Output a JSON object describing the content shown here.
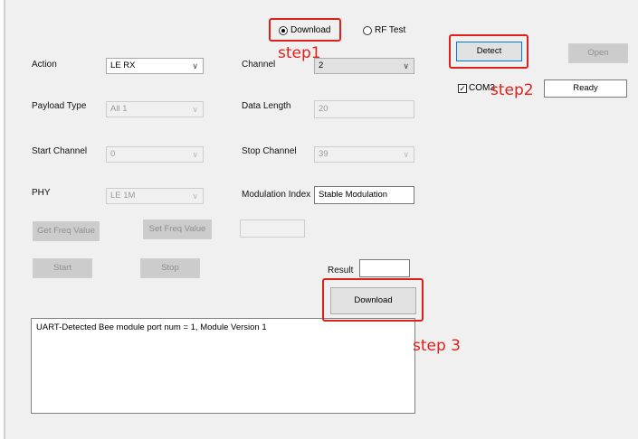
{
  "mode": {
    "download_label": "Download",
    "rf_test_label": "RF Test",
    "selected": "Download"
  },
  "form": {
    "action_label": "Action",
    "action_value": "LE RX",
    "channel_label": "Channel",
    "channel_value": "2",
    "payload_type_label": "Payload Type",
    "payload_type_value": "All 1",
    "data_length_label": "Data Length",
    "data_length_value": "20",
    "start_channel_label": "Start Channel",
    "start_channel_value": "0",
    "stop_channel_label": "Stop Channel",
    "stop_channel_value": "39",
    "phy_label": "PHY",
    "phy_value": "LE 1M",
    "modulation_index_label": "Modulation Index",
    "modulation_index_value": "Stable Modulation",
    "freq_value": ""
  },
  "buttons": {
    "get_freq": "Get Freq Value",
    "set_freq": "Set Freq Value",
    "start": "Start",
    "stop": "Stop",
    "download": "Download",
    "detect": "Detect",
    "open": "Open"
  },
  "result": {
    "label": "Result",
    "value": ""
  },
  "port": {
    "com_label": "COM3",
    "checked": true,
    "status": "Ready"
  },
  "log": {
    "text": "UART-Detected Bee module port num = 1, Module Version 1"
  },
  "annotations": {
    "step1": "step1",
    "step2": "step2",
    "step3": "step 3",
    "color": "#e0201a"
  },
  "icons": {
    "dropdown": "chevron-down-icon",
    "checkbox": "check-icon",
    "radio": "radio-icon"
  }
}
